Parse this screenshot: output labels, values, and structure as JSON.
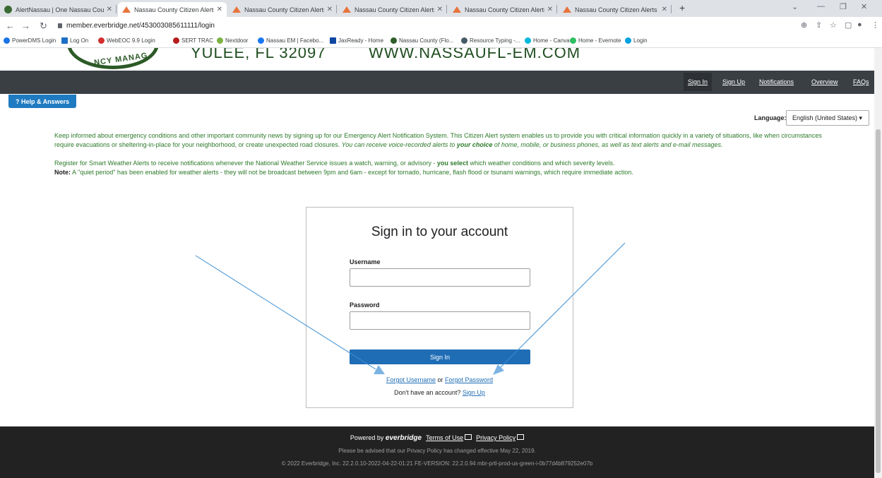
{
  "browser": {
    "tabs": [
      {
        "title": "AlertNassau | One Nassau Count",
        "active": false
      },
      {
        "title": "Nassau County Citizen Alerts - Si",
        "active": true
      },
      {
        "title": "Nassau County Citizen Alerts - Fl",
        "active": false
      },
      {
        "title": "Nassau County Citizen Alerts - Si",
        "active": false
      },
      {
        "title": "Nassau County Citizen Alerts - H",
        "active": false
      },
      {
        "title": "Nassau County Citizen Alerts - H",
        "active": false
      }
    ],
    "new_tab": "+",
    "url": "member.everbridge.net/453003085611111/login",
    "bookmarks": [
      "PowerDMS Login",
      "Log On",
      "WebEOC 9.9 Login",
      "SERT TRAC",
      "Nextdoor",
      "Nassau EM | Facebo...",
      "JaxReady - Home",
      "Nassau County (Flo...",
      "Resource Typing -...",
      "Home - Canva",
      "Home - Evernote",
      "Login"
    ]
  },
  "header": {
    "logo_text": "NCY MANAG",
    "city_line": "YULEE, FL 32097",
    "web_line": "WWW.NASSAUFL-EM.COM"
  },
  "nav": {
    "sign_in": "Sign In",
    "sign_up": "Sign Up",
    "notifications": "Notifications",
    "overview": "Overview",
    "faqs": "FAQs"
  },
  "help_button": "? Help & Answers",
  "language": {
    "label": "Language:",
    "selected": "English (United States) ▾"
  },
  "intro": {
    "p1_main": "Keep informed about emergency conditions and other important community news by signing up for our Emergency Alert Notification System.  This Citizen Alert system enables us to provide you with critical information quickly in a variety of situations, like when circumstances require evacuations or sheltering-in-place for your neighborhood, or create unexpected road closures.  ",
    "p1_italic_a": "You can receive voice-recorded alerts to ",
    "p1_italic_bold": "your choice",
    "p1_italic_b": " of home, mobile, or business phones, as well as text alerts and e-mail messages.",
    "p2_a": "Register for Smart Weather Alerts to receive notifications whenever the National Weather Service issues a watch, warning, or advisory - ",
    "p2_bold": "you select",
    "p2_b": " which weather conditions and which severity levels.",
    "note_label": "Note:",
    "note_text": " A \"quiet period\" has been enabled for weather alerts - they will not be broadcast between 9pm and 6am - except for tornado, hurricane, flash flood or tsunami warnings, which require immediate action."
  },
  "login": {
    "title": "Sign in to your account",
    "username_label": "Username",
    "password_label": "Password",
    "username_value": "",
    "password_value": "",
    "submit": "Sign In",
    "forgot_username": "Forgot Username",
    "or": " or ",
    "forgot_password": "Forgot Password",
    "no_account": "Don't have an account? ",
    "sign_up": "Sign Up"
  },
  "footer": {
    "powered_by": "Powered by ",
    "brand": "everbridge",
    "terms": "Terms of Use",
    "privacy": "Privacy Policy",
    "notice": "Please be advised that our Privacy Policy has changed effective May 22, 2019.",
    "version": "© 2022 Everbridge, Inc.  22.2.0.10-2022-04-22-01:21  FE-VERSION: 22.2.0.94  mbr-prtl-prod-us-green-i-0b77d4b879252e07b"
  },
  "colors": {
    "navbar": "#3a3f44",
    "primary_blue": "#1f6db5",
    "green_text": "#2d7a2a",
    "footer": "#222222",
    "annotation_arrow": "#3b8fd4"
  }
}
